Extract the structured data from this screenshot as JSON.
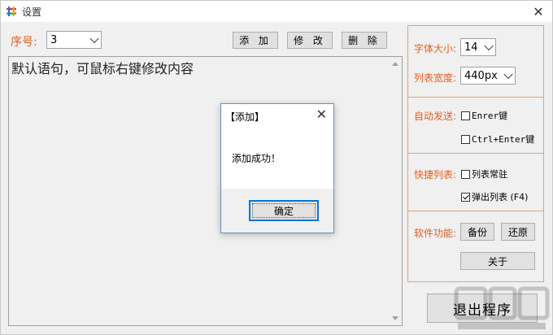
{
  "window": {
    "title": "设置"
  },
  "toolbar": {
    "seq_label": "序号:",
    "seq_value": "3",
    "add_label": "添 加",
    "edit_label": "修 改",
    "delete_label": "删 除"
  },
  "editor": {
    "text": "默认语句，可鼠标右键修改内容"
  },
  "settings": {
    "font_size_label": "字体大小:",
    "font_size_value": "14",
    "list_width_label": "列表宽度:",
    "list_width_value": "440px",
    "auto_send_label": "自动发送:",
    "enter_key_label": "Enrer键",
    "enter_key_checked": false,
    "ctrl_enter_label": "Ctrl+Enter键",
    "ctrl_enter_checked": false,
    "shortcut_label": "快捷列表:",
    "pin_list_label": "列表常驻",
    "pin_list_checked": false,
    "popup_list_label": "弹出列表 (F4)",
    "popup_list_checked": true,
    "features_label": "软件功能:",
    "backup_label": "备份",
    "restore_label": "还原",
    "about_label": "关于"
  },
  "exit_label": "退出程序",
  "dialog": {
    "title": "【添加】",
    "message": "添加成功！",
    "ok_label": "确定"
  },
  "colors": {
    "accent": "#e06020",
    "panel_border": "#e8a070",
    "focus": "#0078d7"
  },
  "icons": [
    "app-icon",
    "close-icon",
    "chevron-down-icon",
    "check-icon",
    "watermark-logo"
  ]
}
